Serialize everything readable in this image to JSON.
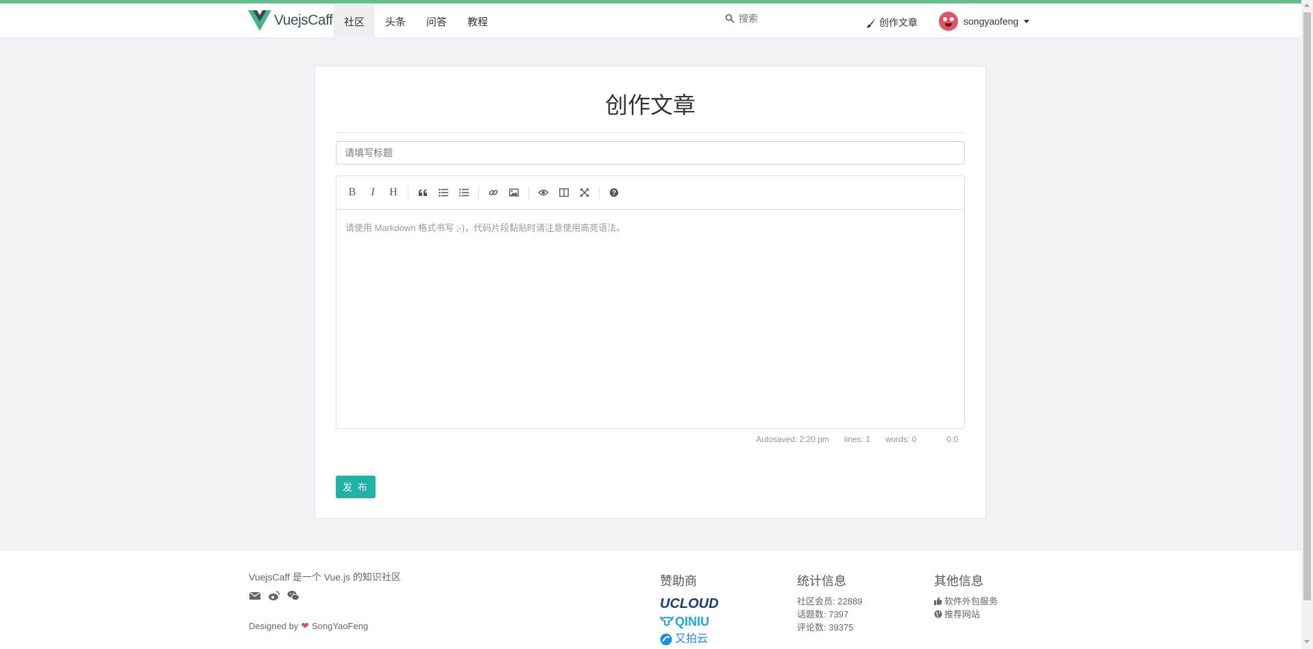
{
  "brand": {
    "name": "VuejsCaff",
    "logo_icon": "vue-logo-icon",
    "colors": {
      "green": "#41b883",
      "dark": "#35495e"
    }
  },
  "nav": {
    "items": [
      {
        "label": "社区",
        "active": true
      },
      {
        "label": "头条",
        "active": false
      },
      {
        "label": "问答",
        "active": false
      },
      {
        "label": "教程",
        "active": false
      }
    ]
  },
  "search": {
    "placeholder": "搜索"
  },
  "header": {
    "create_label": "创作文章",
    "username": "songyaofeng"
  },
  "page": {
    "title": "创作文章"
  },
  "form": {
    "title_placeholder": "请填写标题",
    "editor_placeholder": "请使用 Markdown 格式书写 ;-)，代码片段黏贴时请注意使用高亮语法。",
    "toolbar": {
      "bold": "B",
      "italic": "I",
      "heading": "H",
      "icons": [
        "bold-icon",
        "italic-icon",
        "heading-icon",
        "quote-icon",
        "unordered-list-icon",
        "ordered-list-icon",
        "link-icon",
        "image-icon",
        "preview-icon",
        "side-by-side-icon",
        "fullscreen-icon",
        "help-icon"
      ]
    },
    "status": {
      "autosaved": "Autosaved: 2:20 pm",
      "lines": "lines: 1",
      "words": "words: 0",
      "cursor": "0:0"
    },
    "publish_label": "发 布"
  },
  "footer": {
    "about": "VuejsCaff 是一个 Vue.js 的知识社区",
    "designed_by": "Designed by",
    "designer": "SongYaoFeng",
    "social_icons": [
      "mail-icon",
      "weibo-icon",
      "wechat-icon"
    ],
    "sponsors": {
      "title": "赞助商",
      "items": [
        "UCLOUD",
        "QINIU",
        "又拍云"
      ]
    },
    "stats": {
      "title": "统计信息",
      "members": "社区会员: 22889",
      "topics": "话题数: 7397",
      "comments": "评论数: 39375"
    },
    "other": {
      "title": "其他信息",
      "outsourcing": "软件外包服务",
      "recommend": "推荐网站"
    }
  },
  "colors": {
    "accent": "#21b2a6",
    "topline": "#5fbf8f",
    "background": "#f0f2f5"
  }
}
